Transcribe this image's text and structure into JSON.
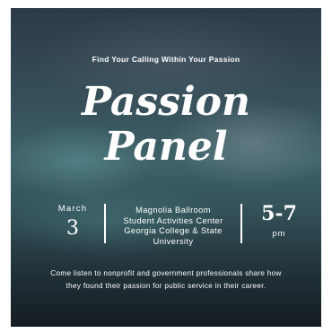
{
  "tagline": "Find Your Calling Within Your Passion",
  "title": {
    "line1": "Passion",
    "line2": "Panel"
  },
  "date": {
    "month": "March",
    "day": "3"
  },
  "venue": {
    "line1": "Magnolia Ballroom",
    "line2": "Student Activities Center",
    "line3": "Georgia College & State",
    "line4": "University"
  },
  "time": {
    "range": "5-7",
    "period": "pm"
  },
  "description": {
    "line1": "Come listen to nonprofit and government professionals share how",
    "line2": "they found their passion for public service in their career."
  },
  "colors": {
    "background_top": "#2c3a47",
    "background_mid": "#3e6268",
    "background_bottom": "#141c22",
    "text": "#ffffff"
  }
}
